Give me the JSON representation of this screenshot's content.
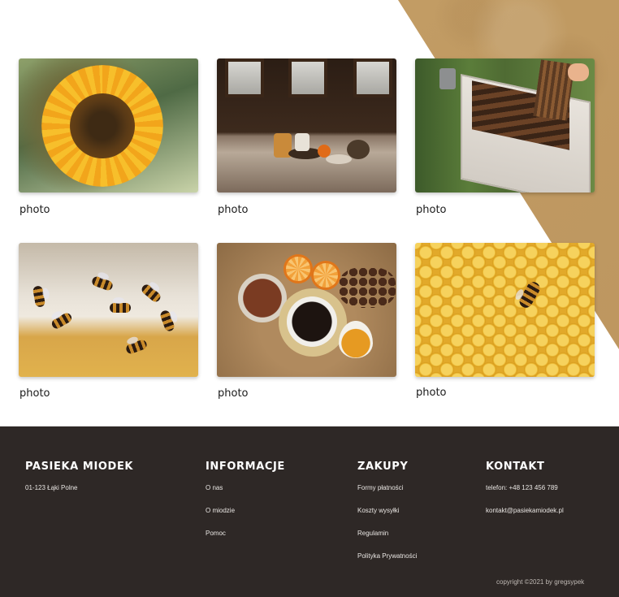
{
  "gallery": {
    "items": [
      {
        "caption": "photo",
        "subject": "sunflower"
      },
      {
        "caption": "photo",
        "subject": "tea-table-by-window"
      },
      {
        "caption": "photo",
        "subject": "beehive-frames"
      },
      {
        "caption": "photo",
        "subject": "bees-on-hive"
      },
      {
        "caption": "photo",
        "subject": "tea-with-honey"
      },
      {
        "caption": "photo",
        "subject": "bee-on-honeycomb"
      }
    ]
  },
  "footer": {
    "brand": {
      "title": "Pasieka Miodek",
      "address": "01-123 Łąki Polne"
    },
    "info": {
      "title": "Informacje",
      "links": [
        "O nas",
        "O miodzie",
        "Pomoc"
      ]
    },
    "shopping": {
      "title": "Zakupy",
      "links": [
        "Formy płatności",
        "Koszty wysyłki",
        "Regulamin",
        "Polityka Prywatności"
      ]
    },
    "contact": {
      "title": "Kontakt",
      "phone": "telefon: +48 123 456 789",
      "email": "kontakt@pasiekamiodek.pl"
    },
    "copyright": "copyright ©2021 by gregsypek"
  },
  "colors": {
    "accent_tan": "#c7a16a",
    "footer_bg": "#2e2826",
    "text_dark": "#1b1b1b"
  }
}
